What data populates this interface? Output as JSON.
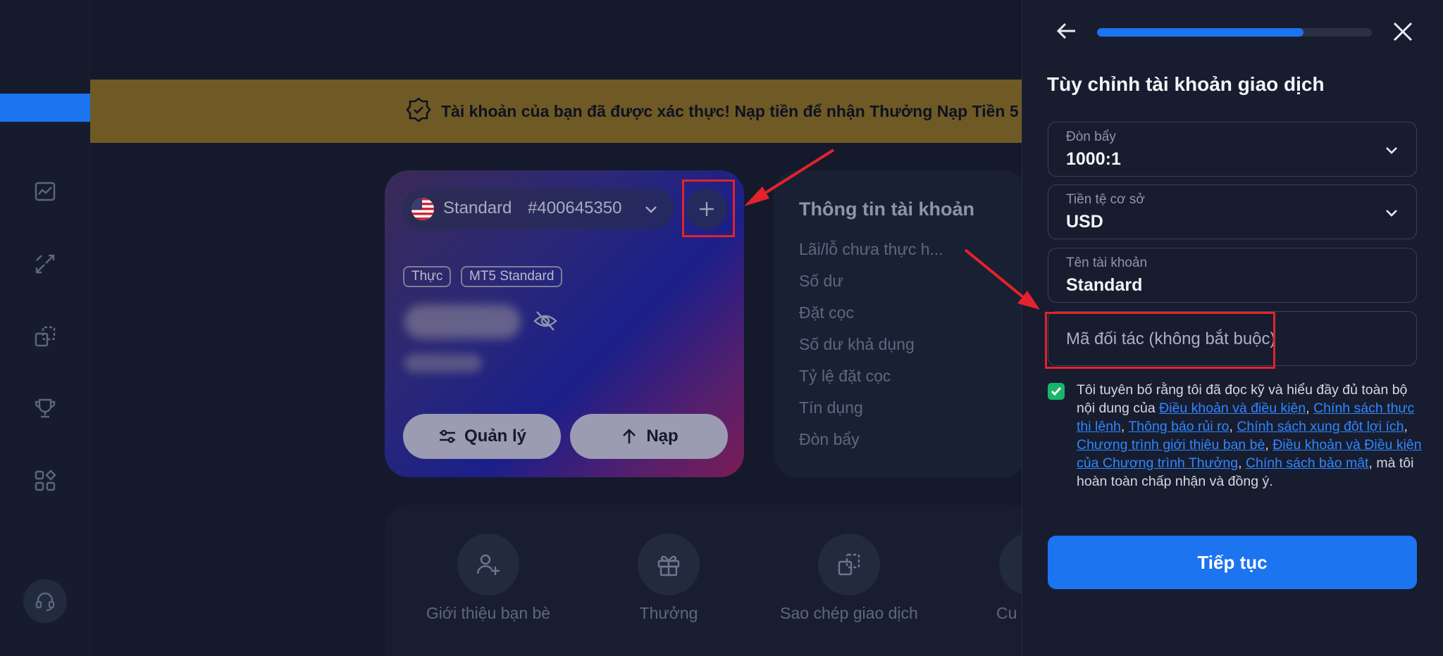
{
  "banner": {
    "text": "Tài khoản của bạn đã được xác thực! Nạp tiền để nhận Thưởng Nạp Tiền 5",
    "bg_color": "#6f5a26"
  },
  "sidebar": {
    "items": [
      {
        "icon": "list-icon",
        "active": true
      },
      {
        "icon": "chart-icon"
      },
      {
        "icon": "transfer-icon"
      },
      {
        "icon": "copy-trade-icon"
      },
      {
        "icon": "trophy-icon"
      },
      {
        "icon": "apps-icon"
      }
    ],
    "support_icon": "headset-icon"
  },
  "account_card": {
    "account_type": "Standard",
    "account_number": "#400645350",
    "tags": [
      "Thực",
      "MT5 Standard"
    ],
    "manage_label": "Quản lý",
    "deposit_label": "Nạp"
  },
  "account_info": {
    "title": "Thông tin tài khoản",
    "rows": [
      "Lãi/lỗ chưa thực h...",
      "Số dư",
      "Đặt cọc",
      "Số dư khả dụng",
      "Tỷ lệ đặt cọc",
      "Tín dụng",
      "Đòn bẩy"
    ]
  },
  "quick_actions": [
    {
      "label": "Giới thiệu bạn bè",
      "icon": "add-user-icon"
    },
    {
      "label": "Thưởng",
      "icon": "gift-icon"
    },
    {
      "label": "Sao chép giao dịch",
      "icon": "copy-icon"
    },
    {
      "label": "Cu",
      "icon": "cup-icon"
    }
  ],
  "panel": {
    "title": "Tùy chỉnh tài khoản giao dịch",
    "progress": 0.75,
    "fields": {
      "leverage": {
        "label": "Đòn bẩy",
        "value": "1000:1"
      },
      "currency": {
        "label": "Tiền tệ cơ sở",
        "value": "USD"
      },
      "account_name": {
        "label": "Tên tài khoản",
        "value": "Standard"
      },
      "partner_code": {
        "placeholder": "Mã đối tác (không bắt buộc)"
      }
    },
    "terms": {
      "checked": true,
      "prefix": "Tôi tuyên bố rằng tôi đã đọc kỹ và hiểu đầy đủ toàn bộ nội dung của ",
      "links": [
        "Điều khoản và điều kiện",
        "Chính sách thực thi lệnh",
        "Thông báo rủi ro",
        "Chính sách xung đột lợi ích",
        "Chương trình giới thiệu bạn bè",
        "Điều khoản và Điều kiện của Chương trình Thưởng",
        "Chính sách bảo mật"
      ],
      "separator": ", ",
      "suffix": ", mà tôi hoàn toàn chấp nhận và đồng ý."
    },
    "continue_label": "Tiếp tục"
  },
  "colors": {
    "accent": "#1c74f0",
    "annotation_red": "#e3222b",
    "checkbox_green": "#19b56b"
  }
}
